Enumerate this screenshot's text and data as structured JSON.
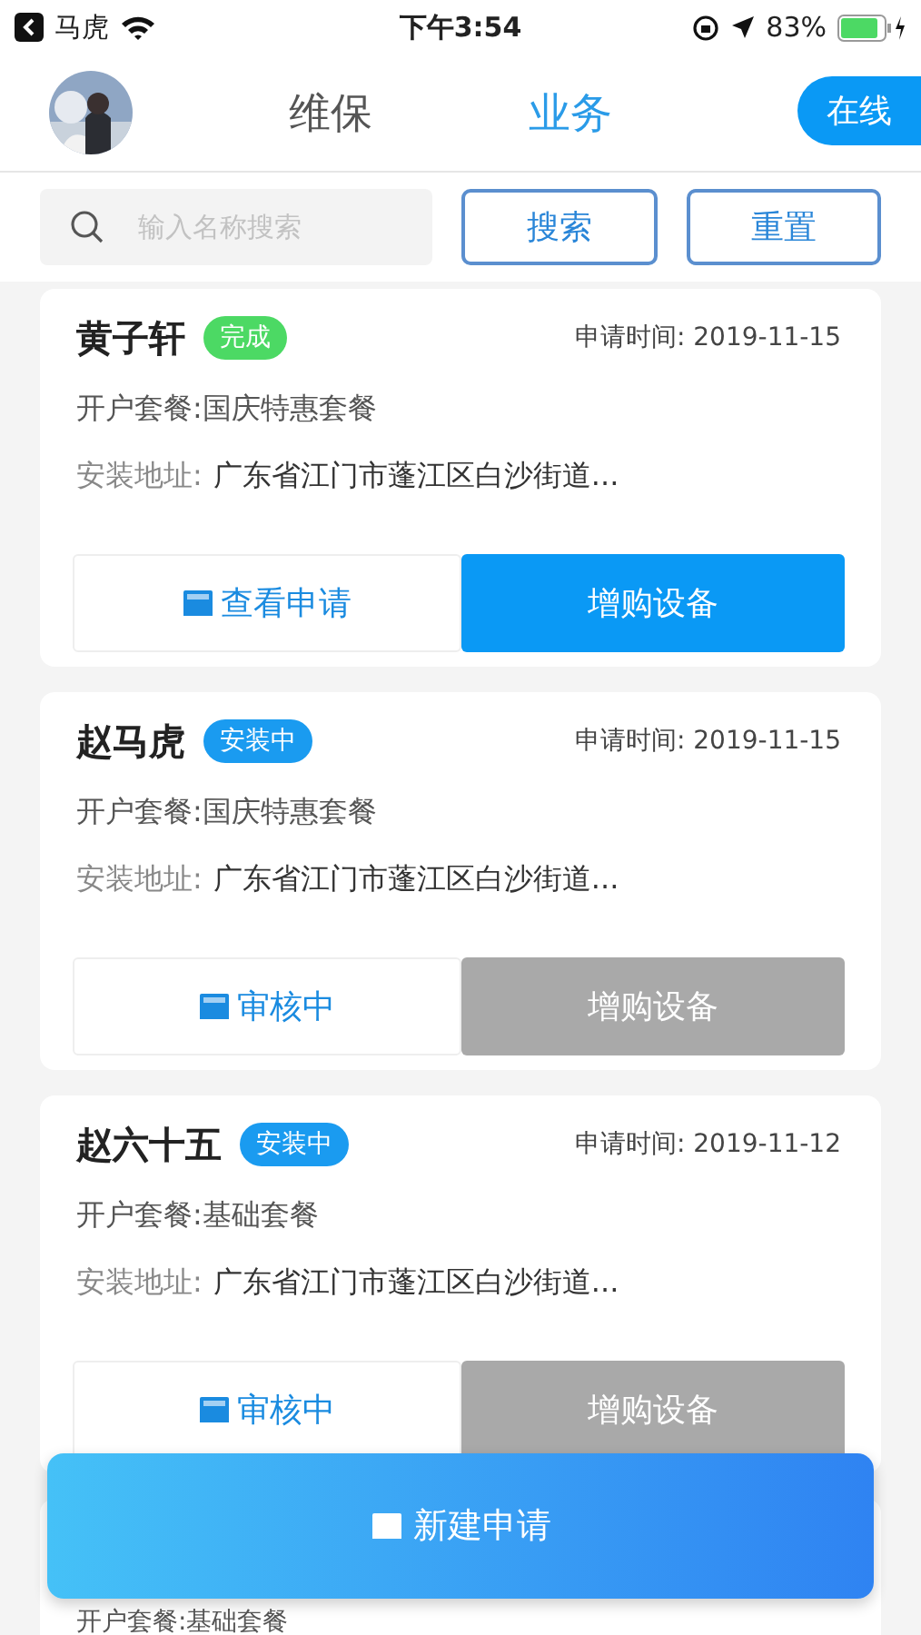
{
  "status_bar": {
    "back_app": "马虎",
    "time": "下午3:54",
    "battery": "83%"
  },
  "header": {
    "tabs": [
      {
        "label": "维保",
        "selected": false
      },
      {
        "label": "业务",
        "selected": true
      }
    ],
    "online_badge": "在线"
  },
  "search": {
    "placeholder": "输入名称搜索",
    "search_button": "搜索",
    "reset_button": "重置"
  },
  "applications": [
    {
      "name": "黄子轩",
      "status": {
        "label": "完成",
        "color": "#4cd964"
      },
      "date": "申请时间: 2019-11-15",
      "package": "开户套餐:国庆特惠套餐",
      "address_label": "安装地址:",
      "address": "广东省江门市蓬江区白沙街道...",
      "view_button": "查看申请",
      "buy_button": {
        "label": "增购设备",
        "disabled": false
      }
    },
    {
      "name": "赵马虎",
      "status": {
        "label": "安装中",
        "color": "#1a9bf0"
      },
      "date": "申请时间: 2019-11-15",
      "package": "开户套餐:国庆特惠套餐",
      "address_label": "安装地址:",
      "address": "广东省江门市蓬江区白沙街道...",
      "view_button": "审核中",
      "buy_button": {
        "label": "增购设备",
        "disabled": true
      }
    },
    {
      "name": "赵六十五",
      "status": {
        "label": "安装中",
        "color": "#1a9bf0"
      },
      "date": "申请时间: 2019-11-12",
      "package": "开户套餐:基础套餐",
      "address_label": "安装地址:",
      "address": "广东省江门市蓬江区白沙街道...",
      "view_button": "审核中",
      "buy_button": {
        "label": "增购设备",
        "disabled": true
      }
    }
  ],
  "partial_row": "开户套餐:基础套餐",
  "new_button": "新建申请"
}
